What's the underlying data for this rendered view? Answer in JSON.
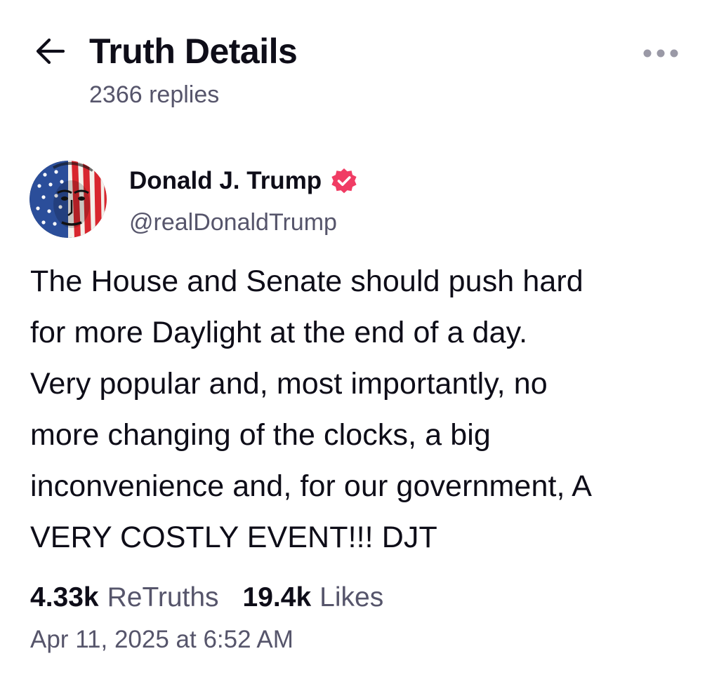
{
  "header": {
    "title": "Truth Details",
    "reply_count": "2366 replies",
    "back_icon": "arrow-left-icon",
    "more_icon": "ellipsis-icon"
  },
  "post": {
    "author": {
      "display_name": "Donald J. Trump",
      "handle": "@realDonaldTrump",
      "verified": true
    },
    "text": "The House and Senate should push hard\nfor more Daylight at the end of a day.\nVery popular and, most importantly, no\nmore changing of the clocks, a big\ninconvenience and, for our government, A\nVERY COSTLY EVENT!!!  DJT",
    "stats": {
      "retruths_count": "4.33k",
      "retruths_label": "ReTruths",
      "likes_count": "19.4k",
      "likes_label": "Likes"
    },
    "timestamp": "Apr 11, 2025 at 6:52 AM"
  },
  "colors": {
    "text_primary": "#0e0d18",
    "text_secondary": "#56556b",
    "verified_badge": "#f03c64",
    "more_dots": "#9a99a6"
  }
}
